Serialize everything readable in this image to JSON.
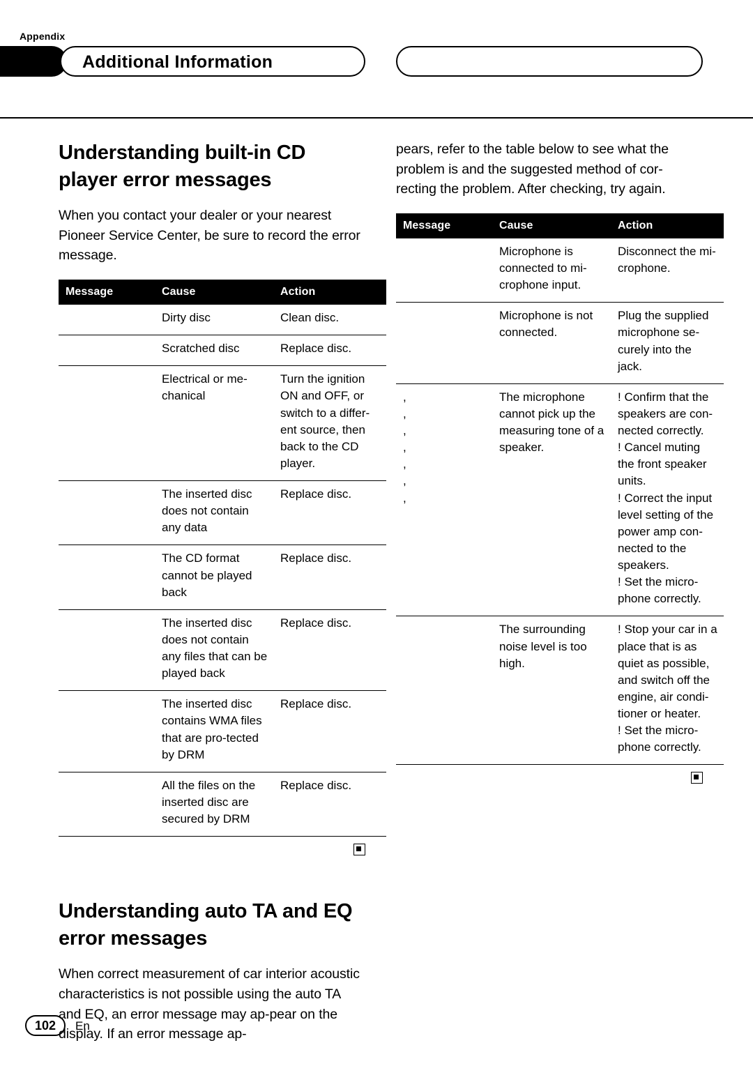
{
  "header": {
    "appendix_label": "Appendix",
    "title": "Additional Information"
  },
  "left_column": {
    "heading": "Understanding built-in CD player error messages",
    "intro": "When you contact your dealer or your nearest Pioneer Service Center, be sure to record the error message.",
    "table": {
      "columns": [
        "Message",
        "Cause",
        "Action"
      ],
      "rows": [
        {
          "message": "",
          "cause": "Dirty disc",
          "action": "Clean disc."
        },
        {
          "message": "",
          "cause": "Scratched disc",
          "action": "Replace disc."
        },
        {
          "message": "",
          "cause": "Electrical or me-chanical",
          "action": "Turn the ignition ON and OFF, or switch to a differ-ent source, then back to the CD player."
        },
        {
          "message": "",
          "cause": "The inserted disc does not contain any data",
          "action": "Replace disc."
        },
        {
          "message": "",
          "cause": "The CD format cannot be played back",
          "action": "Replace disc."
        },
        {
          "message": "",
          "cause": "The inserted disc does not contain any files that can be played back",
          "action": "Replace disc."
        },
        {
          "message": "",
          "cause": "The inserted disc contains WMA files that are pro-tected by DRM",
          "action": "Replace disc."
        },
        {
          "message": "",
          "cause": "All the files on the inserted disc are secured by DRM",
          "action": "Replace disc."
        }
      ]
    },
    "heading2": "Understanding auto TA and EQ error messages",
    "intro2": "When correct measurement of car interior acoustic characteristics is not possible using the auto TA and EQ, an error message may ap-pear on the display. If an error message ap-"
  },
  "right_column": {
    "intro_continued": "pears, refer to the table below to see what the problem is and the suggested method of cor-recting the problem. After checking, try again.",
    "table": {
      "columns": [
        "Message",
        "Cause",
        "Action"
      ],
      "rows": [
        {
          "message": "",
          "cause": "Microphone is connected to mi-crophone input.",
          "action": "Disconnect the mi-crophone."
        },
        {
          "message": "",
          "cause": "Microphone is not connected.",
          "action": "Plug the supplied microphone se-curely into the jack."
        },
        {
          "message": ",\n,\n,\n,\n,\n,\n,",
          "cause": "The microphone cannot pick up the measuring tone of a speaker.",
          "action": "! Confirm that the speakers are con-nected correctly.\n! Cancel muting the front speaker units.\n! Correct the input level setting of the power amp con-nected to the speakers.\n! Set the micro-phone correctly."
        },
        {
          "message": "",
          "cause": "The surrounding noise level is too high.",
          "action": "! Stop your car in a place that is as quiet as possible, and switch off the engine, air condi-tioner or heater.\n! Set the micro-phone correctly."
        }
      ]
    }
  },
  "footer": {
    "page_number": "102",
    "language": "En"
  }
}
